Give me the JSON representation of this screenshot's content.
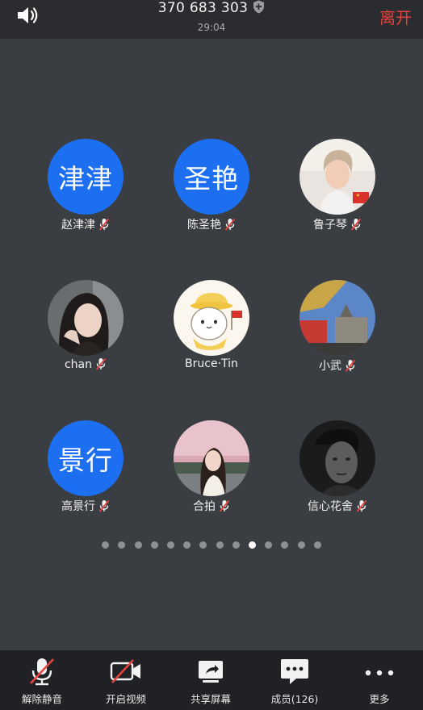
{
  "header": {
    "meeting_id": "370 683 303",
    "timer": "29:04",
    "leave_label": "离开"
  },
  "participants": [
    {
      "name": "赵津津",
      "avatar_text": "津津",
      "avatar": "text"
    },
    {
      "name": "陈圣艳",
      "avatar_text": "圣艳",
      "avatar": "text"
    },
    {
      "name": "鲁子琴",
      "avatar": "photo-man-flag"
    },
    {
      "name": "chan",
      "avatar": "photo-woman"
    },
    {
      "name": "Bruce·Tin",
      "avatar": "cartoon-cat"
    },
    {
      "name": "小武",
      "avatar": "photo-building"
    },
    {
      "name": "高景行",
      "avatar_text": "景行",
      "avatar": "text"
    },
    {
      "name": "合拍",
      "avatar": "photo-girl-sunset"
    },
    {
      "name": "信心花舍",
      "avatar": "photo-man-bw"
    }
  ],
  "pagination": {
    "total": 14,
    "current": 10
  },
  "toolbar": {
    "unmute": "解除静音",
    "start_video": "开启视频",
    "share_screen": "共享屏幕",
    "members": "成员(126)",
    "more": "更多"
  },
  "colors": {
    "background": "#3a3d41",
    "topbar": "#2a2c2f",
    "toolbar": "#1f2124",
    "avatar_blue": "#1c6ff0",
    "leave_red": "#e8423e",
    "muted_red": "#e8423e"
  }
}
